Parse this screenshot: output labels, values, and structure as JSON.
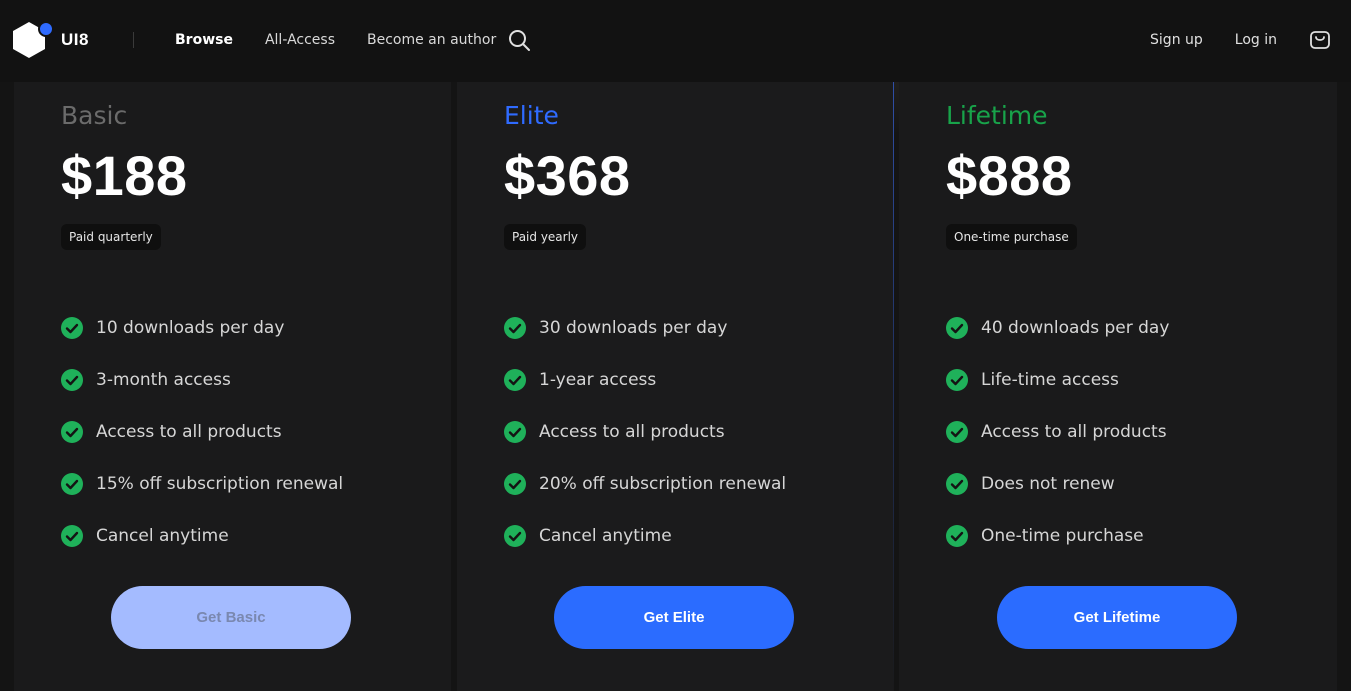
{
  "header": {
    "logo_text": "UI8",
    "nav": [
      "Browse",
      "All-Access",
      "Become an author"
    ],
    "active_nav": "Browse",
    "sign_up": "Sign up",
    "log_in": "Log in"
  },
  "colors": {
    "basic_accent": "#6b6b6b",
    "elite_accent": "#2f6bff",
    "lifetime_accent": "#18a34a",
    "check_green": "#1fb15a",
    "button_blue": "#2b6cff",
    "button_disabled": "#a4bbff"
  },
  "plans": [
    {
      "name": "Basic",
      "price": "$188",
      "billing": "Paid quarterly",
      "features": [
        "10 downloads per day",
        "3-month access",
        "Access to all products",
        "15% off subscription renewal",
        "Cancel anytime"
      ],
      "cta": "Get Basic",
      "cta_state": "disabled"
    },
    {
      "name": "Elite",
      "price": "$368",
      "billing": "Paid yearly",
      "features": [
        "30 downloads per day",
        "1-year access",
        "Access to all products",
        "20% off subscription renewal",
        "Cancel anytime"
      ],
      "cta": "Get Elite",
      "cta_state": "enabled"
    },
    {
      "name": "Lifetime",
      "price": "$888",
      "billing": "One-time purchase",
      "features": [
        "40 downloads per day",
        "Life-time access",
        "Access to all products",
        "Does not renew",
        "One-time purchase"
      ],
      "cta": "Get Lifetime",
      "cta_state": "enabled"
    }
  ],
  "icons": {
    "logo": "ui8-logo-icon",
    "search": "search-icon",
    "cart": "shopping-bag-icon",
    "check": "check-circle-icon"
  }
}
